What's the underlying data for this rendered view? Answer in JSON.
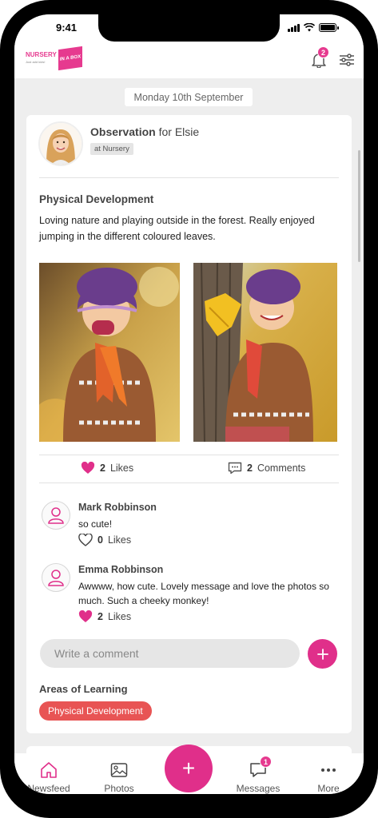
{
  "status_bar": {
    "time": "9:41"
  },
  "header": {
    "logo_main": "NURSERY",
    "logo_box": "IN A BOX",
    "logo_tagline": "Just add kids!",
    "notification_count": "2"
  },
  "feed": {
    "date_label": "Monday 10th September",
    "observation": {
      "title_bold": "Observation",
      "title_rest": " for Elsie",
      "location": "at Nursery",
      "area_title": "Physical Development",
      "text": "Loving nature and playing outside in the forest. Really enjoyed jumping in the different coloured leaves.",
      "likes_count": "2",
      "likes_label": "Likes",
      "comments_count": "2",
      "comments_label": "Comments",
      "comments": [
        {
          "name": "Mark Robbinson",
          "text": "so cute!",
          "likes_count": "0",
          "likes_label": "Likes"
        },
        {
          "name": "Emma Robbinson",
          "text": "Awwww, how cute. Lovely message and love the photos so much. Such a cheeky monkey!",
          "likes_count": "2",
          "likes_label": "Likes"
        }
      ],
      "comment_placeholder": "Write a comment",
      "areas_title": "Areas of Learning",
      "areas": [
        "Physical Development"
      ]
    }
  },
  "nav": {
    "items": [
      {
        "label": "Newsfeed",
        "icon": "home-icon"
      },
      {
        "label": "Photos",
        "icon": "photos-icon"
      },
      {
        "label": "Messages",
        "icon": "messages-icon",
        "badge": "1"
      },
      {
        "label": "More",
        "icon": "more-icon"
      }
    ],
    "fab_symbol": "+"
  },
  "colors": {
    "brand": "#e02f8a",
    "tag_red": "#e85454",
    "background": "#eeeeee"
  }
}
